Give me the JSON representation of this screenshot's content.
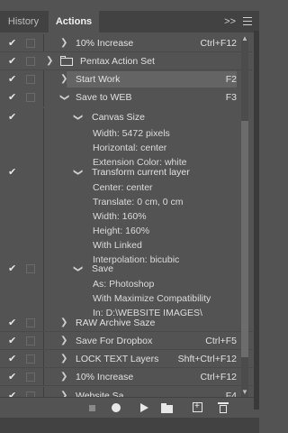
{
  "tabs": {
    "history": "History",
    "actions": "Actions"
  },
  "header": {
    "expand": ">>"
  },
  "rows": [
    {
      "type": "action",
      "label": "10% Increase",
      "key": "Ctrl+F12"
    },
    {
      "type": "set",
      "label": "Pentax Action Set"
    },
    {
      "type": "action",
      "label": "Start Work",
      "key": "F2",
      "selected": true
    },
    {
      "type": "action",
      "label": "Save to WEB",
      "key": "F3",
      "expanded": true
    },
    {
      "type": "step",
      "label": "Canvas Size",
      "details": [
        "Width: 5472 pixels",
        "Horizontal: center",
        "Extension Color: white"
      ]
    },
    {
      "type": "step",
      "label": "Transform current layer",
      "details": [
        "Center: center",
        "Translate: 0 cm, 0 cm",
        "Width: 160%",
        "Height: 160%",
        "With Linked",
        "Interpolation: bicubic"
      ]
    },
    {
      "type": "step",
      "label": "Save",
      "details": [
        "As: Photoshop",
        "With Maximize Compatibility",
        "In: D:\\WEBSITE IMAGES\\"
      ]
    },
    {
      "type": "action",
      "label": "RAW Archive Saze",
      "key": ""
    },
    {
      "type": "action",
      "label": "Save For Dropbox",
      "key": "Ctrl+F5"
    },
    {
      "type": "action",
      "label": "LOCK TEXT Layers",
      "key": "Shft+Ctrl+F12"
    },
    {
      "type": "action",
      "label": "10% Increase",
      "key": "Ctrl+F12"
    },
    {
      "type": "action",
      "label": "Website Sa...",
      "key": "F4"
    }
  ],
  "icons": {
    "check": "checkmark-icon",
    "collapsed": "chevron-right-icon",
    "expanded": "chevron-down-icon",
    "folder": "folder-icon"
  },
  "toolbar": {
    "stop": "stop-icon",
    "record": "record-icon",
    "play": "play-icon",
    "new_set": "folder-icon",
    "new_action": "new-action-icon",
    "delete": "trash-icon"
  },
  "colors": {
    "panel": "#535353",
    "header": "#424242",
    "selected": "#646464"
  }
}
